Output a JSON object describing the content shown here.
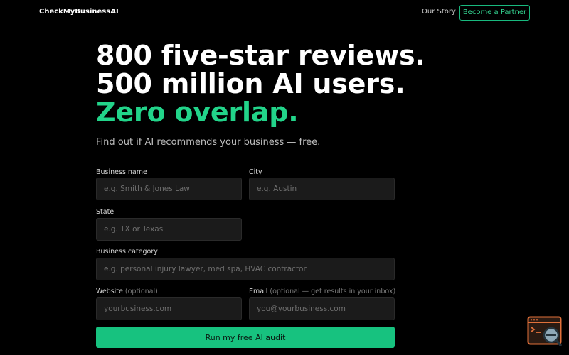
{
  "header": {
    "brand": "CheckMyBusinessAI",
    "nav_story": "Our Story",
    "partner_button": "Become a Partner"
  },
  "hero": {
    "line1": "800 five-star reviews.",
    "line2": "500 million AI users.",
    "line3": "Zero overlap.",
    "subtitle": "Find out if AI recommends your business — free."
  },
  "form": {
    "business_name": {
      "label": "Business name",
      "placeholder": "e.g. Smith & Jones Law",
      "value": ""
    },
    "city": {
      "label": "City",
      "placeholder": "e.g. Austin",
      "value": ""
    },
    "state": {
      "label": "State",
      "placeholder": "e.g. TX or Texas",
      "value": ""
    },
    "category": {
      "label": "Business category",
      "placeholder": "e.g. personal injury lawyer, med spa, HVAC contractor",
      "value": ""
    },
    "website": {
      "label": "Website",
      "optional": "(optional)",
      "placeholder": "yourbusiness.com",
      "value": ""
    },
    "email": {
      "label": "Email",
      "optional": "(optional — get results in your inbox)",
      "placeholder": "you@yourbusiness.com",
      "value": ""
    },
    "submit": "Run my free AI audit"
  },
  "colors": {
    "accent": "#22d48a",
    "button": "#17c27f",
    "background": "#000000",
    "input_bg": "#1b1b1b",
    "widget": "#e0703a"
  },
  "icons": {
    "widget": "terminal-search-icon"
  }
}
